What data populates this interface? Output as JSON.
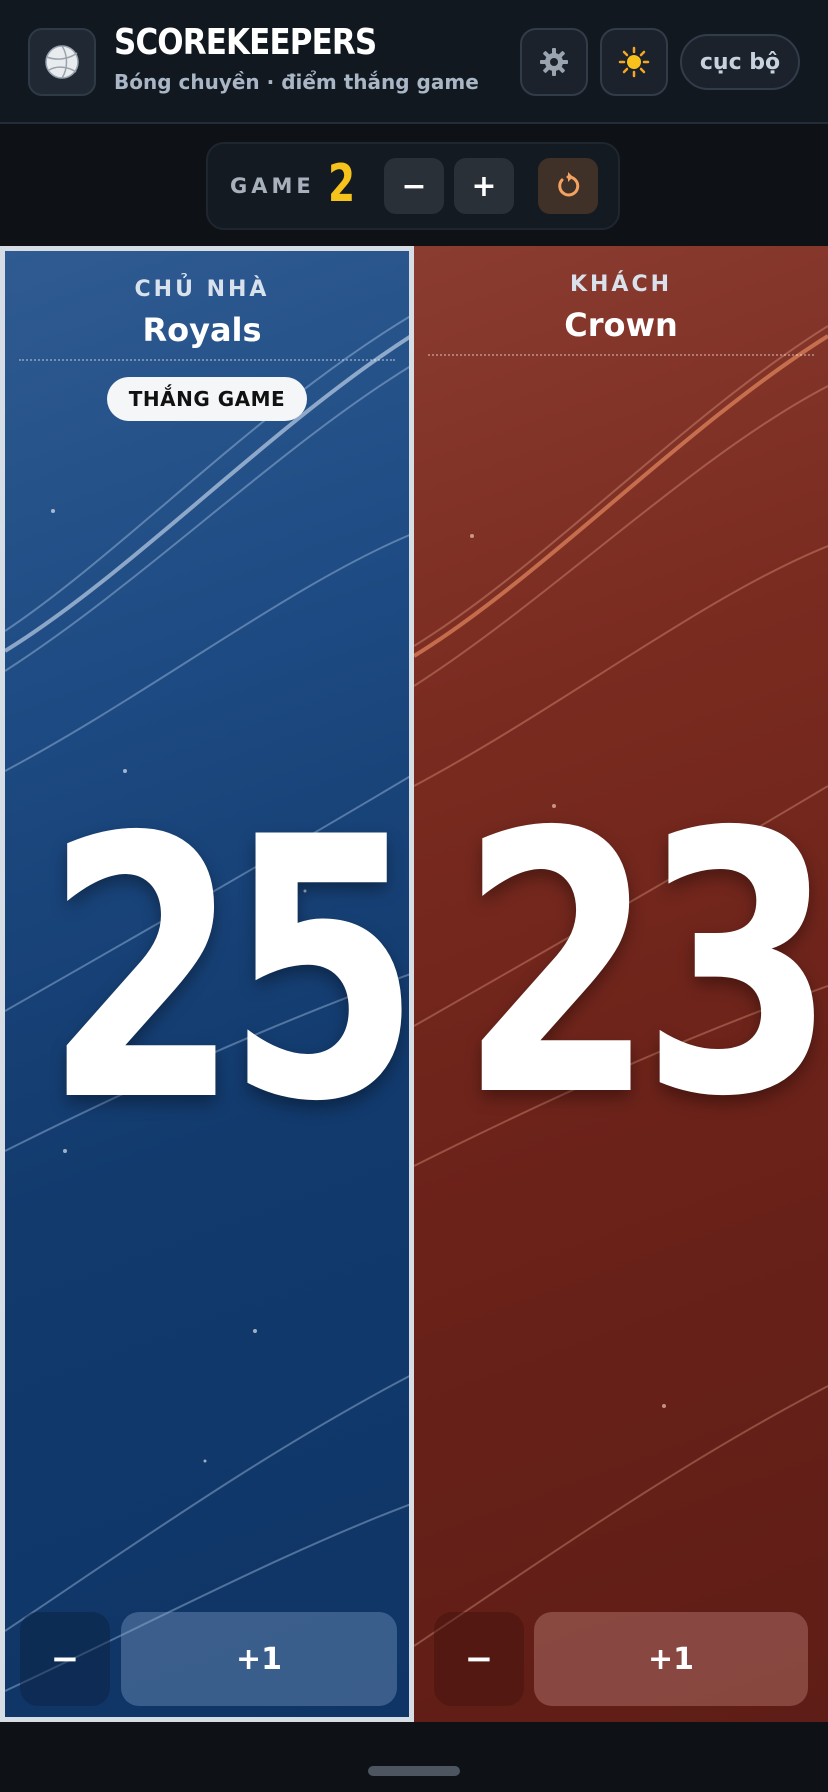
{
  "header": {
    "title": "SCOREKEEPERS",
    "subtitle": "Bóng chuyền · điểm thắng game",
    "app_icon": "volleyball-icon",
    "settings_icon": "gear-icon",
    "theme_icon": "sun-icon",
    "mode_label": "cục bộ"
  },
  "game": {
    "label": "GAME",
    "number": "2",
    "decrement_label": "−",
    "increment_label": "+",
    "reset_icon": "reset-icon"
  },
  "teams": {
    "home": {
      "role": "CHỦ NHÀ",
      "name": "Royals",
      "badge": "THẮNG GAME",
      "score": "25",
      "minus_label": "−",
      "plus_label": "+1",
      "color": "#1d4a82"
    },
    "away": {
      "role": "KHÁCH",
      "name": "Crown",
      "score": "23",
      "minus_label": "−",
      "plus_label": "+1",
      "color": "#7a2b20"
    }
  },
  "colors": {
    "accent_game_number": "#f6c21c",
    "background": "#0e1217"
  }
}
